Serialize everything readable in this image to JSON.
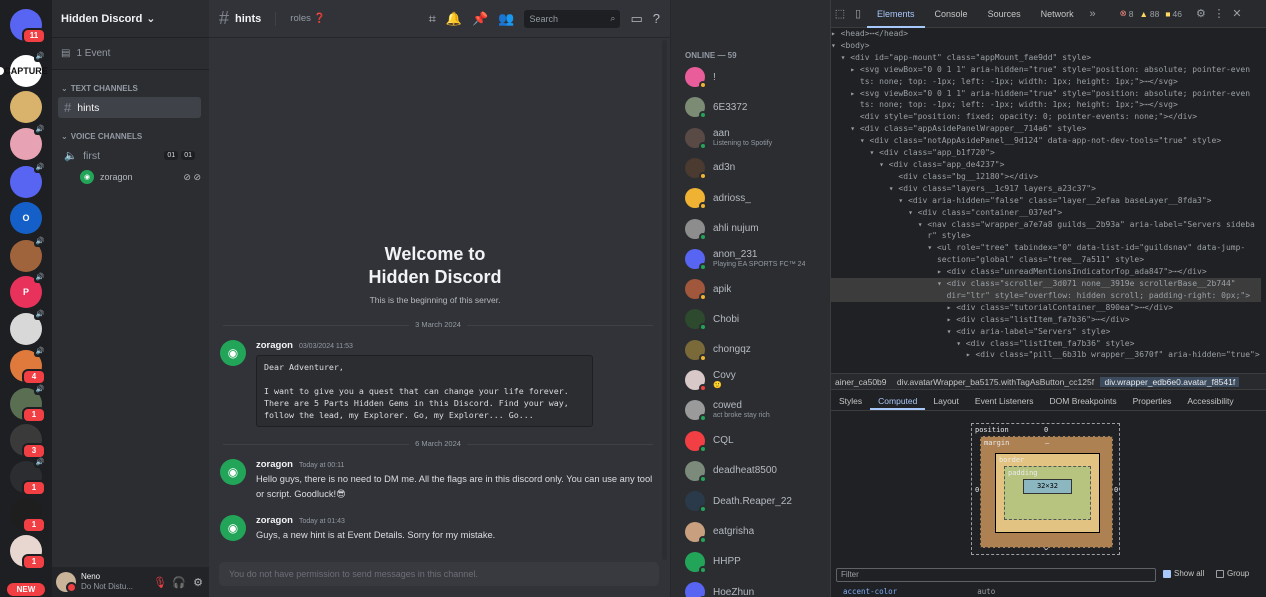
{
  "guilds": [
    {
      "label": "",
      "color": "#5865f2",
      "badge": "11"
    },
    {
      "label": "CAPTURE",
      "color": "#ffffff",
      "badge": "",
      "speaker": true
    },
    {
      "label": "",
      "color": "#d9b36c",
      "badge": ""
    },
    {
      "label": "",
      "color": "#e7a3b4",
      "badge": "",
      "speaker": true
    },
    {
      "label": "",
      "color": "#5865f2",
      "badge": "",
      "speaker": true
    },
    {
      "label": "O",
      "color": "#1560c8",
      "badge": ""
    },
    {
      "label": "",
      "color": "#a0643c",
      "badge": "",
      "speaker": true
    },
    {
      "label": "P",
      "color": "#e8315b",
      "badge": "",
      "speaker": true
    },
    {
      "label": "",
      "color": "#d8d8d8",
      "badge": "",
      "speaker": true
    },
    {
      "label": "",
      "color": "#e07a3c",
      "badge": "4",
      "speaker": true
    },
    {
      "label": "",
      "color": "#5a6e52",
      "badge": "1",
      "speaker": true
    },
    {
      "label": "",
      "color": "#3a3a3a",
      "badge": "3"
    },
    {
      "label": "",
      "color": "#2b2d31",
      "badge": "1",
      "speaker": true
    },
    {
      "label": "",
      "color": "#1e1e1e",
      "badge": "1"
    },
    {
      "label": "",
      "color": "#e8d7d0",
      "badge": "1"
    }
  ],
  "new_badge": "NEW",
  "server": {
    "name": "Hidden Discord",
    "events": "1 Event",
    "text_category": "TEXT CHANNELS",
    "voice_category": "VOICE CHANNELS",
    "text_channel": "hints",
    "voice_channel": "first",
    "voice_count_a": "01",
    "voice_count_b": "01",
    "voice_user": "zoragon"
  },
  "userbar": {
    "name": "Neno",
    "status": "Do Not Distu..."
  },
  "channel": {
    "name": "hints",
    "topic": "roles ❓",
    "search_placeholder": "Search",
    "welcome_line1": "Welcome to",
    "welcome_line2": "Hidden Discord",
    "welcome_sub": "This is the beginning of this server.",
    "date1": "3 March 2024",
    "date2": "6 March 2024",
    "composer": "You do not have permission to send messages in this channel."
  },
  "messages": [
    {
      "author": "zoragon",
      "time": "03/03/2024 11:53",
      "code": "Dear Adventurer,\n\nI want to give you a quest that can change your life forever. There are 5 Parts Hidden Gems in this Discord. Find your way, follow the lead, my Explorer. Go, my Explorer... Go..."
    },
    {
      "author": "zoragon",
      "time": "Today at 00:11",
      "text": "Hello guys, there is no need to DM me. All the flags are in this discord only. You can use any tool or script. Goodluck!😎"
    },
    {
      "author": "zoragon",
      "time": "Today at 01:43",
      "text": "Guys, a new hint is at Event Details. Sorry for my mistake."
    }
  ],
  "members_header": "ONLINE — 59",
  "members": [
    {
      "name": "!",
      "color": "#e85d9a",
      "status": "#f0b232",
      "activity": ""
    },
    {
      "name": "6E3372",
      "color": "#7c8b74",
      "status": "#23a559",
      "activity": ""
    },
    {
      "name": "aan",
      "color": "#5a4a46",
      "status": "#23a559",
      "activity": "Listening to Spotify"
    },
    {
      "name": "ad3n",
      "color": "#4a3a30",
      "status": "#f0b232",
      "activity": ""
    },
    {
      "name": "adrioss_",
      "color": "#f0b232",
      "status": "#f0b232",
      "activity": ""
    },
    {
      "name": "ahli nujum",
      "color": "#8d8d8d",
      "status": "#23a559",
      "activity": ""
    },
    {
      "name": "anon_231",
      "color": "#5865f2",
      "status": "#23a559",
      "activity": "Playing EA SPORTS FC™ 24"
    },
    {
      "name": "apik",
      "color": "#a0573c",
      "status": "#f0b232",
      "activity": ""
    },
    {
      "name": "Chobi",
      "color": "#2e4a2e",
      "status": "#23a559",
      "activity": ""
    },
    {
      "name": "chongqz",
      "color": "#7a6a3a",
      "status": "#f0b232",
      "activity": ""
    },
    {
      "name": "Covy",
      "color": "#d8c8c8",
      "status": "#f23f43",
      "activity": "🙂"
    },
    {
      "name": "cowed",
      "color": "#9a9a9a",
      "status": "#23a559",
      "activity": "act broke stay rich"
    },
    {
      "name": "CQL",
      "color": "#f23f43",
      "status": "#23a559",
      "activity": ""
    },
    {
      "name": "deadheat8500",
      "color": "#7b8a7b",
      "status": "#23a559",
      "activity": ""
    },
    {
      "name": "Death.Reaper_22",
      "color": "#2a3a4a",
      "status": "#23a559",
      "activity": ""
    },
    {
      "name": "eatgrisha",
      "color": "#c8a080",
      "status": "#23a559",
      "activity": ""
    },
    {
      "name": "HHPP",
      "color": "#23a559",
      "status": "#23a559",
      "activity": ""
    },
    {
      "name": "HoeZhun",
      "color": "#5865f2",
      "status": "#23a559",
      "activity": ""
    }
  ],
  "devtools": {
    "tabs": [
      "Elements",
      "Console",
      "Sources",
      "Network"
    ],
    "errors": "8",
    "warnings": "88",
    "issues": "46",
    "dom_lines": [
      "▸ <head>⋯</head>",
      "▾ <body>",
      "  ▾ <div id=\"app-mount\" class=\"appMount_fae9dd\" style>",
      "    ▸ <svg viewBox=\"0 0 1 1\" aria-hidden=\"true\" style=\"position: absolute; pointer-even",
      "      ts: none; top: -1px; left: -1px; width: 1px; height: 1px;\">⋯</svg>",
      "    ▸ <svg viewBox=\"0 0 1 1\" aria-hidden=\"true\" style=\"position: absolute; pointer-even",
      "      ts: none; top: -1px; left: -1px; width: 1px; height: 1px;\">⋯</svg>",
      "      <div style=\"position: fixed; opacity: 0; pointer-events: none;\"></div>",
      "    ▾ <div class=\"appAsidePanelWrapper__714a6\" style>",
      "      ▾ <div class=\"notAppAsidePanel__9d124\" data-app-not-dev-tools=\"true\" style>",
      "        ▾ <div class=\"app_b1f720\">",
      "          ▾ <div class=\"app_de4237\">",
      "              <div class=\"bg__12180\"></div>",
      "            ▾ <div class=\"layers__1c917 layers_a23c37\">",
      "              ▾ <div aria-hidden=\"false\" class=\"layer__2efaa baseLayer__8fda3\">",
      "                ▾ <div class=\"container__037ed\">",
      "                  ▾ <nav class=\"wrapper_a7e7a8 guilds__2b93a\" aria-label=\"Servers sideba",
      "                    r\" style>",
      "                    ▾ <ul role=\"tree\" tabindex=\"0\" data-list-id=\"guildsnav\" data-jump-",
      "                      section=\"global\" class=\"tree__7a511\" style>",
      "                      ▸ <div class=\"unreadMentionsIndicatorTop_ada847\">⋯</div>",
      "                      ▾ <div class=\"scroller__3d071 none__3919e scrollerBase__2b744\"",
      "                        dir=\"ltr\" style=\"overflow: hidden scroll; padding-right: 0px;\">",
      "                        ▸ <div class=\"tutorialContainer__890ea\">⋯</div>",
      "                        ▸ <div class=\"listItem_fa7b36\">⋯</div>",
      "                        ▾ <div aria-label=\"Servers\" style>",
      "                          ▾ <div class=\"listItem_fa7b36\" style>",
      "                            ▸ <div class=\"pill__6b31b wrapper__3670f\" aria-hidden=\"true\">"
    ],
    "breadcrumbs": [
      "ainer_ca50b9",
      "div.avatarWrapper_ba5175.withTagAsButton_cc125f",
      "div.wrapper_edb6e0.avatar_f8541f"
    ],
    "panel_tabs": [
      "Styles",
      "Computed",
      "Layout",
      "Event Listeners",
      "DOM Breakpoints",
      "Properties",
      "Accessibility"
    ],
    "box": {
      "position": "position",
      "margin": "margin",
      "border": "border",
      "padding": "padding",
      "content": "32×32",
      "zero": "0",
      "dash": "–"
    },
    "filter_placeholder": "Filter",
    "show_all": "Show all",
    "group": "Group",
    "last_prop": "accent-color",
    "last_val": "auto"
  }
}
